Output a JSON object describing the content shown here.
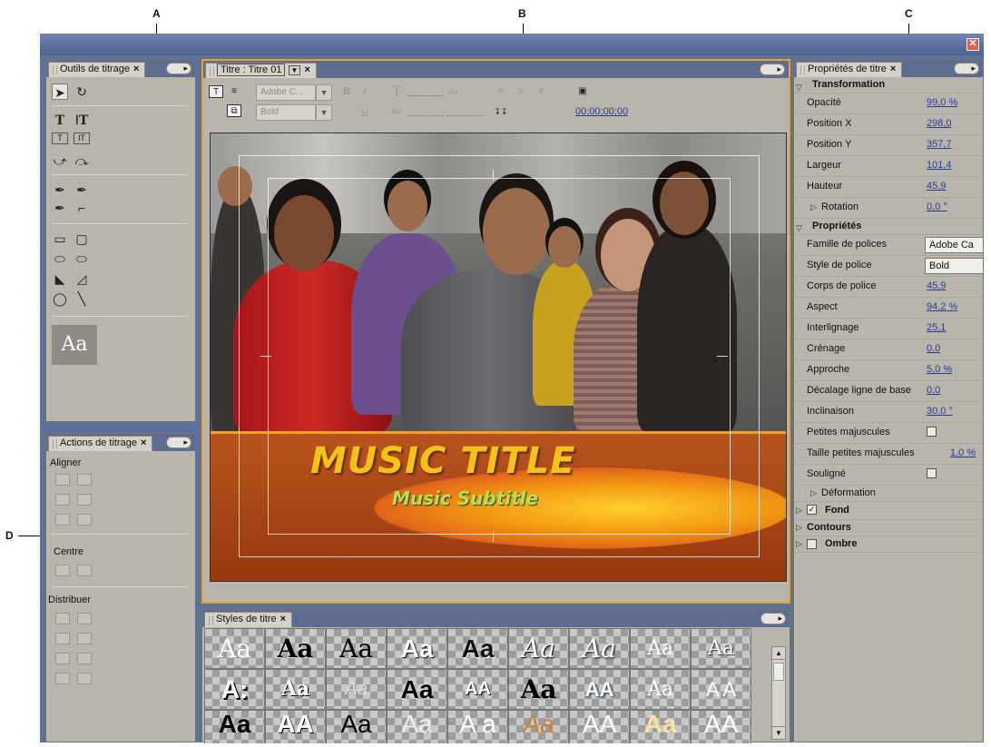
{
  "callouts": {
    "a": "A",
    "b": "B",
    "c": "C",
    "d": "D"
  },
  "tools_panel": {
    "tab": "Outils de titrage",
    "tools": [
      "selection-tool",
      "rotation-tool",
      "type-tool",
      "vertical-type-tool",
      "area-type-tool",
      "vertical-area-type-tool",
      "path-type-tool",
      "vertical-path-type-tool",
      "pen-tool",
      "delete-anchor-tool",
      "add-anchor-tool",
      "convert-anchor-tool",
      "rectangle-tool",
      "rounded-rectangle-tool",
      "clipped-corner-rectangle-tool",
      "rounded-corner-rectangle-tool",
      "wedge-tool",
      "arc-tool",
      "ellipse-tool",
      "line-tool"
    ],
    "sample": "Aa"
  },
  "actions_panel": {
    "tab": "Actions de titrage",
    "align": "Aligner",
    "center": "Centre",
    "distribute": "Distribuer"
  },
  "title_panel": {
    "tab": "Titre : Titre 01",
    "font_family": "Adobe C...",
    "font_style": "Bold",
    "timecode": "00;00;00;00",
    "music_title": "MUSIC TITLE",
    "music_subtitle": "Music Subtitle"
  },
  "styles_panel": {
    "tab": "Styles de titre",
    "samples": [
      "Aa",
      "Aa",
      "Aa",
      "Aa",
      "Aa",
      "Aa",
      "Aa",
      "Aa",
      "Aa",
      "A:",
      "Aa",
      "Aa",
      "Aa",
      "AA",
      "Aa",
      "AA",
      "Aa",
      "A A",
      "Aa",
      "AA",
      "Aa",
      "Aa",
      "A a",
      "Aa",
      "AA",
      "Aa",
      "AA"
    ]
  },
  "properties_panel": {
    "tab": "Propriétés de titre",
    "transformation": "Transformation",
    "opacity": {
      "label": "Opacité",
      "value": "99,0 %"
    },
    "pos_x": {
      "label": "Position X",
      "value": "298,0"
    },
    "pos_y": {
      "label": "Position Y",
      "value": "357,7"
    },
    "width": {
      "label": "Largeur",
      "value": "101,4"
    },
    "height": {
      "label": "Hauteur",
      "value": "45,9"
    },
    "rotation": {
      "label": "Rotation",
      "value": "0,0 °"
    },
    "properties": "Propriétés",
    "font_family": {
      "label": "Famille de polices",
      "value": "Adobe Ca"
    },
    "font_style": {
      "label": "Style de police",
      "value": "Bold"
    },
    "font_size": {
      "label": "Corps de police",
      "value": "45,9"
    },
    "aspect": {
      "label": "Aspect",
      "value": "94,2 %"
    },
    "leading": {
      "label": "Interlignage",
      "value": "25,1"
    },
    "kerning": {
      "label": "Crénage",
      "value": "0,0"
    },
    "tracking": {
      "label": "Approche",
      "value": "5,0 %"
    },
    "baseline": {
      "label": "Décalage ligne de base",
      "value": "0,0"
    },
    "slant": {
      "label": "Inclinaison",
      "value": "30,0 °"
    },
    "small_caps": {
      "label": "Petites majuscules"
    },
    "small_caps_size": {
      "label": "Taille petites majuscules",
      "value": "1,0 %"
    },
    "underline": {
      "label": "Souligné"
    },
    "distort": "Déformation",
    "fill": "Fond",
    "strokes": "Contours",
    "shadow": "Ombre"
  }
}
